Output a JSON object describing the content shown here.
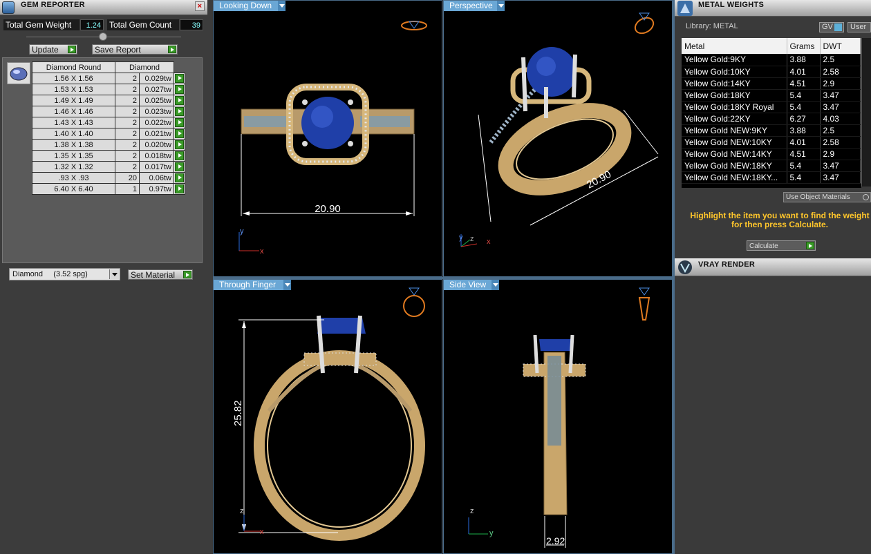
{
  "gem_reporter": {
    "title": "GEM REPORTER",
    "close": "×",
    "total_weight_label": "Total Gem Weight",
    "total_weight_value": "1.24",
    "total_count_label": "Total Gem Count",
    "total_count_value": "39",
    "update_label": "Update",
    "save_report_label": "Save Report",
    "table": {
      "headers": [
        "Diamond Round",
        "Diamond"
      ],
      "rows": [
        {
          "size": "1.56 X 1.56",
          "qty": "2",
          "weight": "0.029tw"
        },
        {
          "size": "1.53 X 1.53",
          "qty": "2",
          "weight": "0.027tw"
        },
        {
          "size": "1.49 X 1.49",
          "qty": "2",
          "weight": "0.025tw"
        },
        {
          "size": "1.46 X 1.46",
          "qty": "2",
          "weight": "0.023tw"
        },
        {
          "size": "1.43 X 1.43",
          "qty": "2",
          "weight": "0.022tw"
        },
        {
          "size": "1.40 X 1.40",
          "qty": "2",
          "weight": "0.021tw"
        },
        {
          "size": "1.38 X 1.38",
          "qty": "2",
          "weight": "0.020tw"
        },
        {
          "size": "1.35 X 1.35",
          "qty": "2",
          "weight": "0.018tw"
        },
        {
          "size": "1.32 X 1.32",
          "qty": "2",
          "weight": "0.017tw"
        },
        {
          "size": ".93 X .93",
          "qty": "20",
          "weight": "0.06tw"
        },
        {
          "size": "6.40 X 6.40",
          "qty": "1",
          "weight": "0.97tw"
        }
      ]
    },
    "material_select": "Diamond     (3.52 spg)",
    "set_material_label": "Set Material"
  },
  "viewports": {
    "top_left": {
      "label": "Looking Down",
      "dimension": "20.90",
      "axes": [
        "y",
        "x"
      ]
    },
    "top_right": {
      "label": "Perspective",
      "dimension": "20.90",
      "axes": [
        "y",
        "z",
        "x"
      ]
    },
    "bottom_left": {
      "label": "Through Finger",
      "dimension": "25.82",
      "axes": [
        "z",
        "x"
      ]
    },
    "bottom_right": {
      "label": "Side View",
      "dimension": "2.92",
      "axes": [
        "z",
        "y"
      ]
    }
  },
  "metal_weights": {
    "title": "METAL WEIGHTS",
    "library_label": "Library: METAL",
    "gv_label": "GV",
    "user_label": "User",
    "columns": [
      "Metal",
      "Grams",
      "DWT"
    ],
    "rows": [
      {
        "metal": "Yellow Gold:9KY",
        "grams": "3.88",
        "dwt": "2.5"
      },
      {
        "metal": "Yellow Gold:10KY",
        "grams": "4.01",
        "dwt": "2.58"
      },
      {
        "metal": "Yellow Gold:14KY",
        "grams": "4.51",
        "dwt": "2.9"
      },
      {
        "metal": "Yellow Gold:18KY",
        "grams": "5.4",
        "dwt": "3.47"
      },
      {
        "metal": "Yellow Gold:18KY Royal",
        "grams": "5.4",
        "dwt": "3.47"
      },
      {
        "metal": "Yellow Gold:22KY",
        "grams": "6.27",
        "dwt": "4.03"
      },
      {
        "metal": "Yellow Gold NEW:9KY",
        "grams": "3.88",
        "dwt": "2.5"
      },
      {
        "metal": "Yellow Gold NEW:10KY",
        "grams": "4.01",
        "dwt": "2.58"
      },
      {
        "metal": "Yellow Gold NEW:14KY",
        "grams": "4.51",
        "dwt": "2.9"
      },
      {
        "metal": "Yellow Gold NEW:18KY",
        "grams": "5.4",
        "dwt": "3.47"
      },
      {
        "metal": "Yellow Gold NEW:18KY...",
        "grams": "5.4",
        "dwt": "3.47"
      }
    ],
    "use_object_materials": "Use Object Materials",
    "hint": "Highlight the item you want to find the weight for then press Calculate.",
    "calculate_label": "Calculate"
  },
  "vray": {
    "title": "VRAY RENDER"
  },
  "colors": {
    "gold": "#c9a66b",
    "gem": "#1f3fa8",
    "viewport_tab": "#6aa7d5",
    "hint": "#ffc62b"
  }
}
